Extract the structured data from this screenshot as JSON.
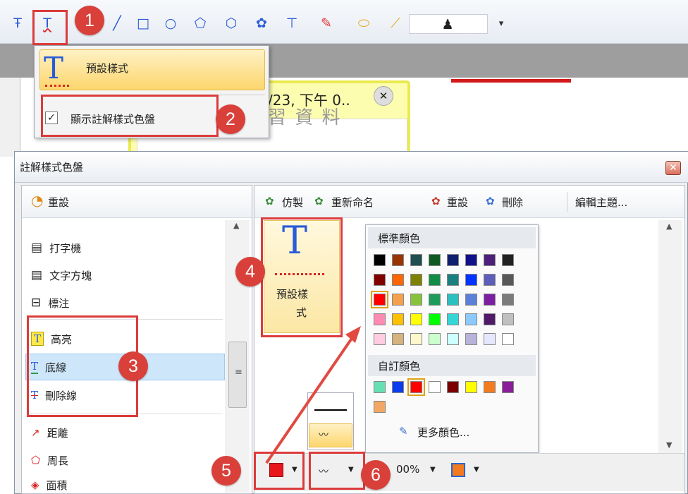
{
  "menu": {
    "default_style": "預設樣式",
    "show_palette": "顯示註解樣式色盤"
  },
  "note": {
    "header": "/23, 下午 0..",
    "body": "習 資 料"
  },
  "panel": {
    "title": "註解樣式色盤",
    "reset": "重設",
    "list_items": [
      "打字機",
      "文字方塊",
      "標注",
      "高亮",
      "底線",
      "刪除線",
      "距離",
      "周長",
      "面積"
    ],
    "toolbar": {
      "duplicate": "仿製",
      "rename": "重新命名",
      "reset": "重設",
      "delete": "刪除",
      "edit_theme": "編輯主題..."
    },
    "style_tile": {
      "line1": "預設樣",
      "line2": "式"
    },
    "palette": {
      "standard_colors": "標準顏色",
      "custom_colors": "自訂顏色",
      "more_colors": "更多顏色..."
    },
    "zoom": "00%"
  },
  "badges": [
    "1",
    "2",
    "3",
    "4",
    "5",
    "6"
  ],
  "colors": {
    "standard": [
      [
        "#000000",
        "#993300",
        "#1f4e4e",
        "#0f5a23",
        "#0f1f6f",
        "#10128a",
        "#4b1f7a",
        "#222222"
      ],
      [
        "#800000",
        "#ff6600",
        "#808000",
        "#118c46",
        "#1a7f7f",
        "#0033ff",
        "#5d5dba",
        "#585858"
      ],
      [
        "#ff0000",
        "#f4a04c",
        "#88c23d",
        "#1f9b59",
        "#2bbfbf",
        "#5c7fd7",
        "#7b1fa2",
        "#7b7b7b"
      ],
      [
        "#ff8bb0",
        "#ffc000",
        "#ffff00",
        "#00ff00",
        "#35d6d6",
        "#8cc9ff",
        "#4f1a67",
        "#c0c0c0"
      ],
      [
        "#ffcce0",
        "#d6b37d",
        "#fff8cc",
        "#ccffcc",
        "#ccffff",
        "#b7b3d9",
        "#e6e6ff",
        "#ffffff"
      ]
    ],
    "custom": [
      "#66e0b3",
      "#0a3cf0",
      "#ff0000",
      "#ffffff",
      "#7a0000",
      "#ffff00",
      "#f47a20",
      "#8a1e9a",
      "#f2a862"
    ]
  }
}
